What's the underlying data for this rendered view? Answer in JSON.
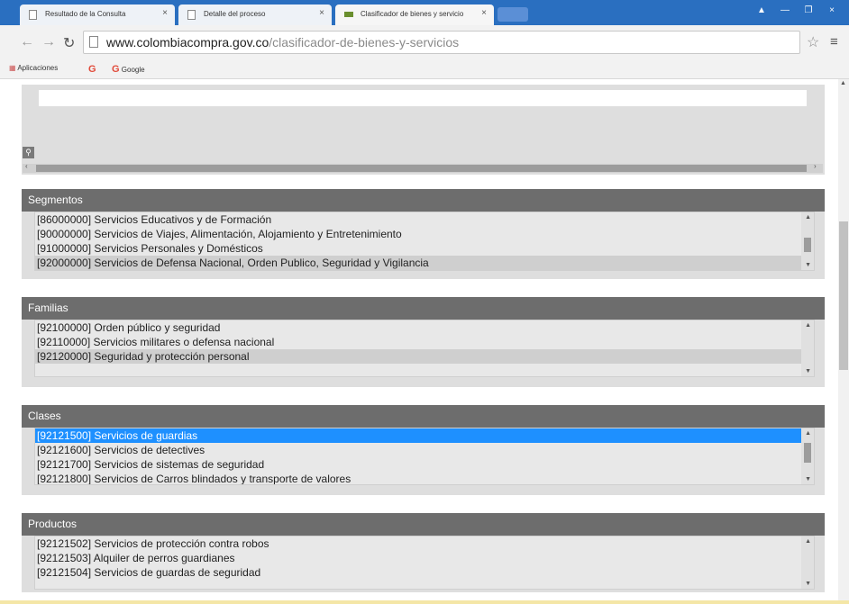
{
  "browser": {
    "tabs": [
      {
        "title": "Resultado de la Consulta"
      },
      {
        "title": "Detalle del proceso"
      },
      {
        "title": "Clasificador de bienes y servicio"
      }
    ],
    "url_host": "www.colombiacompra.gov.co",
    "url_path": "/clasificador-de-bienes-y-servicios",
    "bookmarks": [
      {
        "label": "Aplicaciones"
      },
      {
        "label": "G"
      },
      {
        "label": "Google"
      }
    ]
  },
  "sections": {
    "segmentos": {
      "title": "Segmentos",
      "items": [
        "[86000000] Servicios Educativos y de Formación",
        "[90000000] Servicios de Viajes, Alimentación, Alojamiento y Entretenimiento",
        "[91000000] Servicios Personales y Domésticos",
        "[92000000] Servicios de Defensa Nacional, Orden Publico, Seguridad y Vigilancia"
      ]
    },
    "familias": {
      "title": "Familias",
      "items": [
        "[92100000] Orden público y seguridad",
        "[92110000] Servicios militares o defensa nacional",
        "[92120000] Seguridad y protección personal"
      ]
    },
    "clases": {
      "title": "Clases",
      "items": [
        "[92121500] Servicios de guardias",
        "[92121600] Servicios de detectives",
        "[92121700] Servicios de sistemas de seguridad",
        "[92121800] Servicios de Carros blindados y transporte de valores"
      ]
    },
    "productos": {
      "title": "Productos",
      "items": [
        "[92121502] Servicios de protección contra robos",
        "[92121503] Alquiler de perros guardianes",
        "[92121504] Servicios de guardas de seguridad"
      ]
    }
  },
  "colors": {
    "tabbar": "#2a6fc0",
    "section_header": "#6d6d6d",
    "selected_blue": "#1e90ff"
  }
}
